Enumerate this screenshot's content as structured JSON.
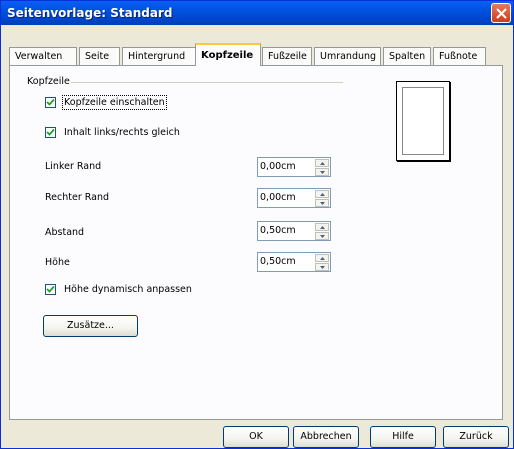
{
  "window": {
    "title": "Seitenvorlage: Standard",
    "close_icon": "close-icon"
  },
  "tabs": [
    {
      "label": "Verwalten"
    },
    {
      "label": "Seite"
    },
    {
      "label": "Hintergrund"
    },
    {
      "label": "Kopfzeile",
      "active": true
    },
    {
      "label": "Fußzeile"
    },
    {
      "label": "Umrandung"
    },
    {
      "label": "Spalten"
    },
    {
      "label": "Fußnote"
    }
  ],
  "header_group": {
    "label": "Kopfzeile",
    "enable_header": {
      "label": "Kopfzeile einschalten",
      "checked": true
    },
    "same_content": {
      "label": "Inhalt links/rechts gleich",
      "checked": true
    },
    "left_margin": {
      "label": "Linker Rand",
      "value": "0,00cm"
    },
    "right_margin": {
      "label": "Rechter Rand",
      "value": "0,00cm"
    },
    "spacing": {
      "label": "Abstand",
      "value": "0,50cm"
    },
    "height": {
      "label": "Höhe",
      "value": "0,50cm"
    },
    "autofit_height": {
      "label": "Höhe dynamisch anpassen",
      "checked": true
    },
    "more_button": "Zusätze..."
  },
  "buttons": {
    "ok": "OK",
    "cancel": "Abbrechen",
    "help": "Hilfe",
    "reset": "Zurück"
  },
  "colors": {
    "titlebar": "#0055e5",
    "active_tab_accent": "#ffc83c",
    "dialog_bg": "#ece9d8"
  }
}
